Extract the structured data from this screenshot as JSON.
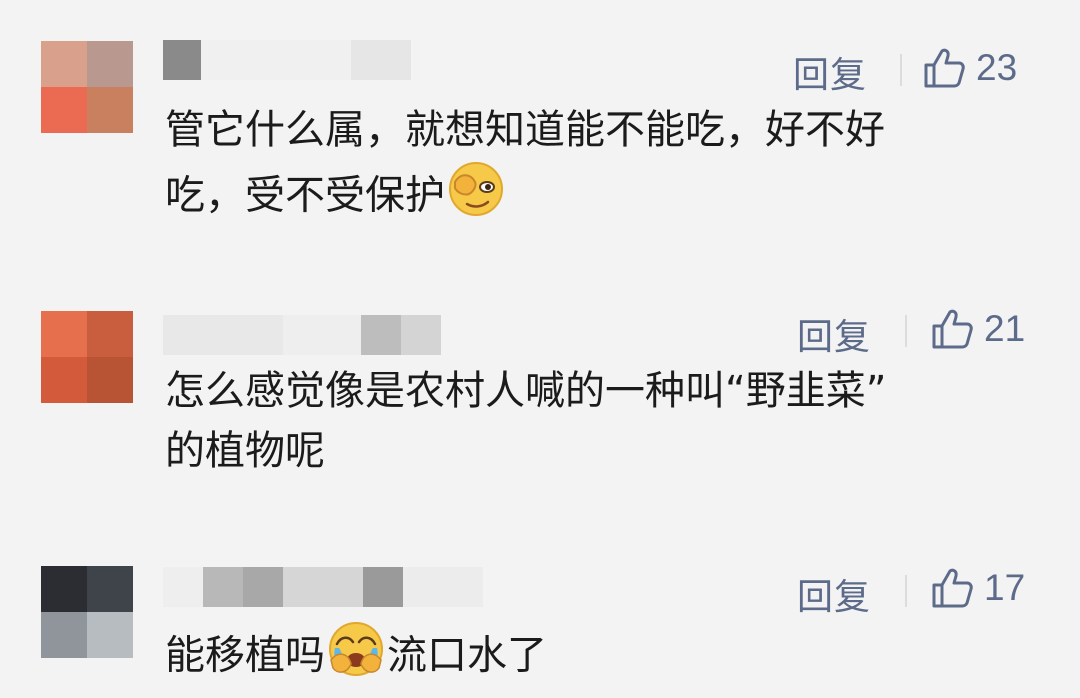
{
  "comments": [
    {
      "reply_label": "回复",
      "like_count": "23",
      "text_line1": "管它什么属，就想知道能不能吃，好不好",
      "text_line2": "吃，受不受保护",
      "emoji": "face-peeking-emoji",
      "colors": {
        "avatar": [
          "#d9a08c",
          "#b9998f",
          "#ea6a52",
          "#c8805f"
        ],
        "name_blocks": [
          "#8a8a8a",
          "#f0f0f0",
          "#dfdfdf"
        ]
      }
    },
    {
      "reply_label": "回复",
      "like_count": "21",
      "text_line1": "怎么感觉像是农村人喊的一种叫“野韭菜”",
      "text_line2": "的植物呢",
      "colors": {
        "avatar": [
          "#e6704d",
          "#c95e3e",
          "#d35a3a",
          "#b85434"
        ],
        "name_blocks": [
          "#e8e8e8",
          "#eeeeee",
          "#bdbdbd",
          "#d4d4d4"
        ]
      }
    },
    {
      "reply_label": "回复",
      "like_count": "17",
      "text_line_before_emoji": "能移植吗",
      "text_line_after_emoji": "流口水了",
      "emoji": "crying-face-emoji",
      "colors": {
        "avatar": [
          "#2b2d33",
          "#3f434a",
          "#8f959b",
          "#b7bcc1"
        ],
        "name_blocks": [
          "#b8b8b8",
          "#a8a8a8",
          "#d6d6d6",
          "#c6c6c6",
          "#9a9a9a",
          "#ececec"
        ]
      }
    }
  ],
  "accent_color": "#5d6b8a"
}
